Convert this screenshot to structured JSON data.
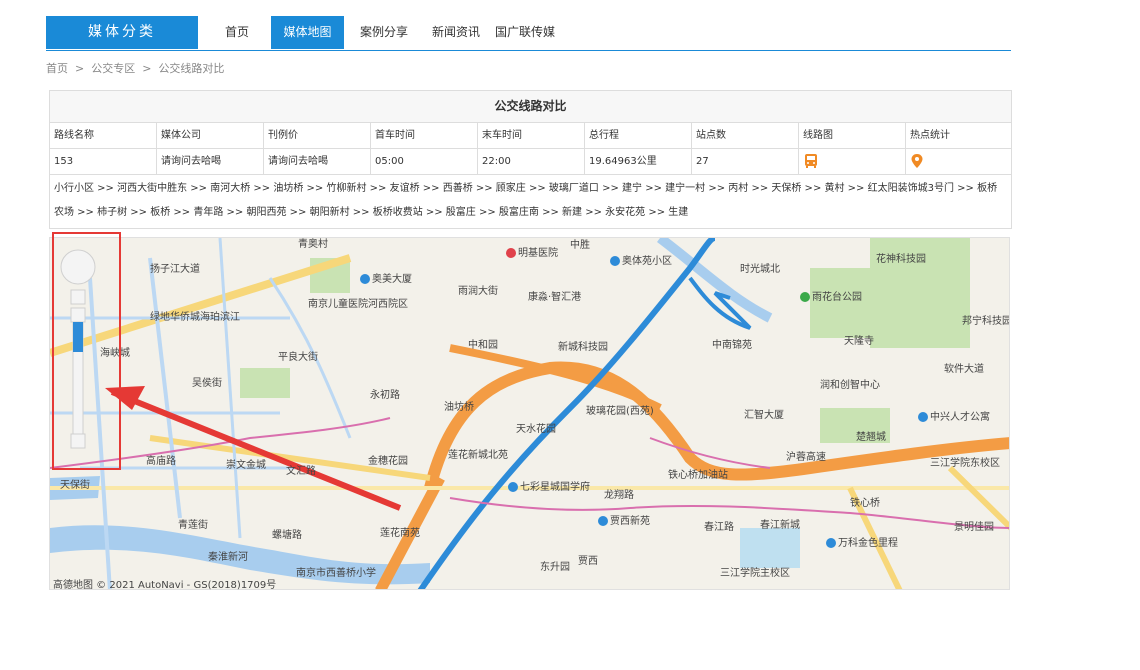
{
  "nav": {
    "category": "媒体分类",
    "items": [
      "首页",
      "媒体地图",
      "案例分享",
      "新闻资讯",
      "国广联传媒"
    ]
  },
  "breadcrumb": [
    "首页",
    "公交专区",
    "公交线路对比"
  ],
  "table": {
    "title": "公交线路对比",
    "headers": [
      "路线名称",
      "媒体公司",
      "刊例价",
      "首车时间",
      "末车时间",
      "总行程",
      "站点数",
      "线路图",
      "热点统计"
    ],
    "row": [
      "153",
      "请询问去哈喝",
      "请询问去哈喝",
      "05:00",
      "22:00",
      "19.64963公里",
      "27"
    ],
    "stops": "小行小区 >> 河西大街中胜东 >> 南河大桥 >> 油坊桥 >> 竹柳新村 >> 友谊桥 >> 西善桥 >> 顾家庄 >> 玻璃厂道口 >> 建宁 >> 建宁一村 >> 丙村 >> 天保桥 >> 黄村 >> 红太阳装饰城3号门 >> 板桥农场 >> 柿子树 >> 板桥 >> 青年路 >> 朝阳西苑 >> 朝阳新村 >> 板桥收费站 >> 殷富庄 >> 殷富庄南 >> 新建 >> 永安花苑 >> 生建"
  },
  "map": {
    "labels": {
      "l1": "青奥村",
      "l2": "明基医院",
      "l3": "中胜",
      "l4": "奥体苑小区",
      "l5": "时光城北",
      "l6": "花神科技园",
      "l7": "扬子江大道",
      "l8": "奥美大厦",
      "l9": "雨润大街",
      "l10": "康淼·智汇港",
      "l11": "南京儿童医院河西院区",
      "l12": "绿地华侨城海珀滨江",
      "l13": "海峡城",
      "l14": "平良大街",
      "l15": "中和园",
      "l16": "新城科技园",
      "l17": "中南锦苑",
      "l18": "雨花台公园",
      "l19": "天隆寺",
      "l20": "邦宁科技园",
      "l21": "软件大道",
      "l22": "吴侯街",
      "l23": "永初路",
      "l24": "油坊桥",
      "l25": "玻璃花园(西苑)",
      "l26": "润和创智中心",
      "l27": "汇智大厦",
      "l28": "中兴人才公寓",
      "l29": "楚翘城",
      "l30": "天水花园",
      "l31": "沪蓉高速",
      "l32": "高庙路",
      "l33": "崇文金城",
      "l34": "文汇路",
      "l35": "金穗花园",
      "l36": "莲花新城北苑",
      "l37": "七彩星城国学府",
      "l38": "铁心桥加油站",
      "l39": "铁心桥",
      "l40": "三江学院东校区",
      "l41": "天保街",
      "l42": "青莲街",
      "l43": "螺塘路",
      "l44": "莲花南苑",
      "l45": "贾西新苑",
      "l46": "春江路",
      "l47": "春江新城",
      "l48": "万科金色里程",
      "l49": "景明佳园",
      "l50": "南京市西善桥小学",
      "l51": "东升园",
      "l52": "贾西",
      "l53": "三江学院主校区",
      "l54": "龙翔路",
      "l55": "秦淮新河"
    },
    "copyright": "高德地图 © 2021 AutoNavi - GS(2018)1709号"
  },
  "colors": {
    "accent": "#1a8ad7",
    "highlight": "#e53935"
  }
}
